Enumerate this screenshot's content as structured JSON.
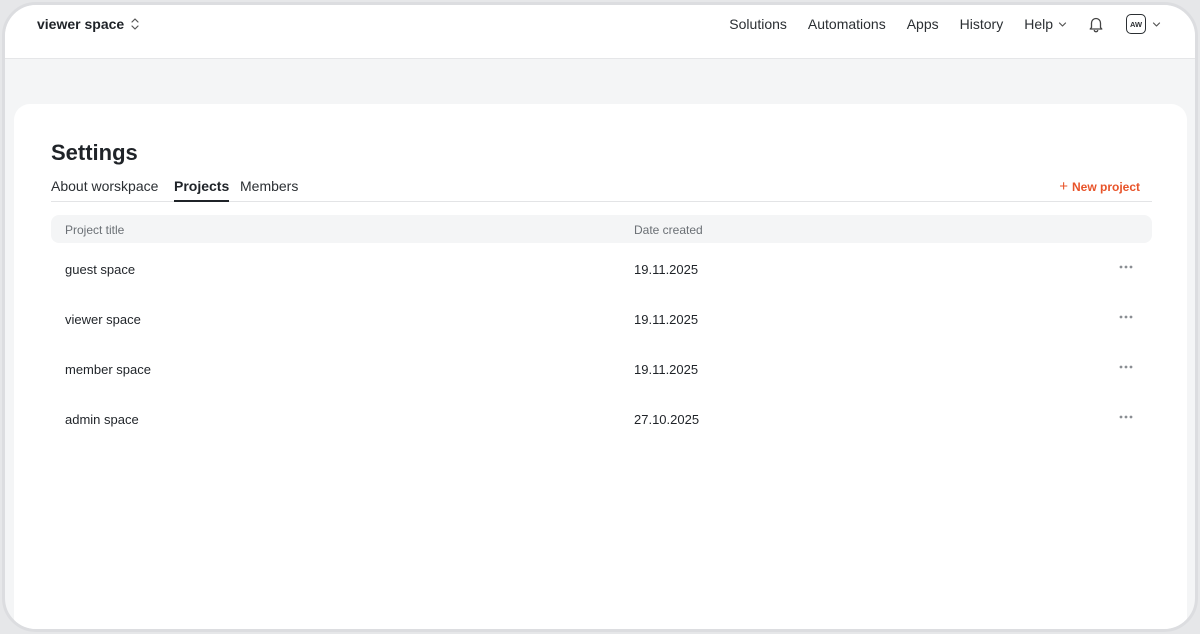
{
  "workspace": {
    "name": "viewer space"
  },
  "nav": {
    "items": [
      {
        "label": "Solutions"
      },
      {
        "label": "Automations"
      },
      {
        "label": "Apps"
      },
      {
        "label": "History"
      },
      {
        "label": "Help"
      }
    ]
  },
  "user": {
    "initials": "AW"
  },
  "settings": {
    "title": "Settings",
    "tabs": [
      {
        "label": "About worskpace"
      },
      {
        "label": "Projects",
        "active": true
      },
      {
        "label": "Members"
      }
    ],
    "new_project_label": "New project",
    "accent_color": "#e8542a"
  },
  "table": {
    "columns": [
      "Project title",
      "Date created"
    ],
    "rows": [
      {
        "title": "guest space",
        "date": "19.11.2025"
      },
      {
        "title": "viewer space",
        "date": "19.11.2025"
      },
      {
        "title": "member space",
        "date": "19.11.2025"
      },
      {
        "title": "admin space",
        "date": "27.10.2025"
      }
    ]
  }
}
